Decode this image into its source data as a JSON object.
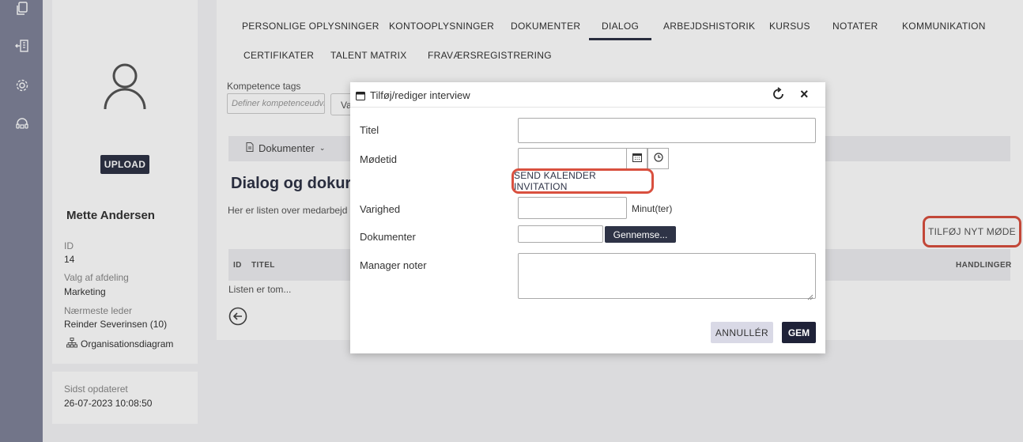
{
  "sidebar": {
    "icons": [
      "documents-icon",
      "exit-building-icon",
      "settings-gear-icon",
      "support-headset-icon"
    ]
  },
  "profile": {
    "upload_label": "UPLOAD",
    "name": "Mette Andersen",
    "fields": [
      {
        "label": "ID",
        "value": "14"
      },
      {
        "label": "Valg af afdeling",
        "value": "Marketing"
      },
      {
        "label": "Nærmeste leder",
        "value": "Reinder Severinsen (10)"
      }
    ],
    "org_link": "Organisationsdiagram",
    "updated_label": "Sidst opdateret",
    "updated_value": "26-07-2023 10:08:50"
  },
  "tabs": [
    "PERSONLIGE OPLYSNINGER",
    "KONTOOPLYSNINGER",
    "DOKUMENTER",
    "DIALOG",
    "ARBEJDSHISTORIK",
    "KURSUS",
    "NOTATER",
    "KOMMUNIKATION",
    "CERTIFIKATER",
    "TALENT MATRIX",
    "FRAVÆRSREGISTRERING"
  ],
  "active_tab": "DIALOG",
  "tags": {
    "label": "Kompetence tags",
    "placeholder": "Definer kompetenceudvikling",
    "button_fragment": "Va"
  },
  "docs_dropdown": "Dokumenter",
  "section": {
    "title": "Dialog og dokur",
    "description": "Her er listen over medarbejd"
  },
  "add_meeting_label": "TILFØJ NYT MØDE",
  "table": {
    "headers": {
      "id": "ID",
      "title": "TITEL",
      "actions": "HANDLINGER"
    },
    "empty": "Listen er tom..."
  },
  "modal": {
    "title": "Tilføj/rediger interview",
    "labels": {
      "title": "Titel",
      "meeting_time": "Mødetid",
      "duration": "Varighed",
      "documents": "Dokumenter",
      "manager_notes": "Manager noter"
    },
    "send_invite_label": "SEND KALENDER INVITATION",
    "duration_unit": "Minut(ter)",
    "browse_label": "Gennemse...",
    "cancel_label": "ANNULLÉR",
    "save_label": "GEM"
  },
  "colors": {
    "rail": "#7f8399",
    "primary_dark": "#2e3346",
    "highlight_red": "#d9503f",
    "cancel_bg": "#d9d9e6"
  }
}
